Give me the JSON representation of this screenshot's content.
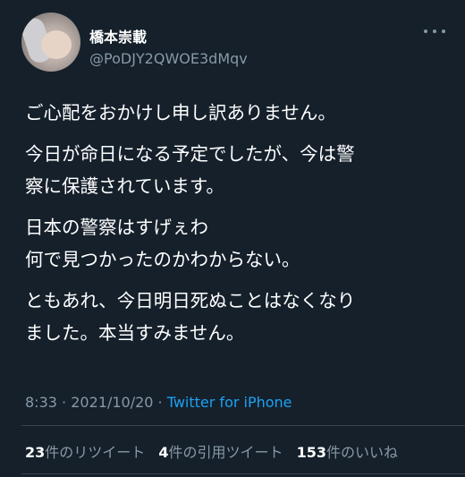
{
  "tweet": {
    "author": {
      "name": "橋本崇載",
      "handle": "@PoDJY2QWOE3dMqv"
    },
    "paragraphs": [
      "ご心配をおかけし申し訳ありません。",
      "今日が命日になる予定でしたが、今は警\n察に保護されています。",
      "日本の警察はすげぇわ\n何で見つかったのかわからない。",
      "ともあれ、今日明日死ぬことはなくなり\nました。本当すみません。"
    ],
    "time": "8:33",
    "date": "2021/10/20",
    "separator": "·",
    "source": "Twitter for iPhone",
    "stats": {
      "retweets_count": "23",
      "retweets_label": "件のリツイート",
      "quotes_count": "4",
      "quotes_label": "件の引用ツイート",
      "likes_count": "153",
      "likes_label": "件のいいね"
    }
  },
  "colors": {
    "background": "#15202b",
    "text": "#ffffff",
    "secondary": "#8899a6",
    "accent": "#1da1f2"
  }
}
